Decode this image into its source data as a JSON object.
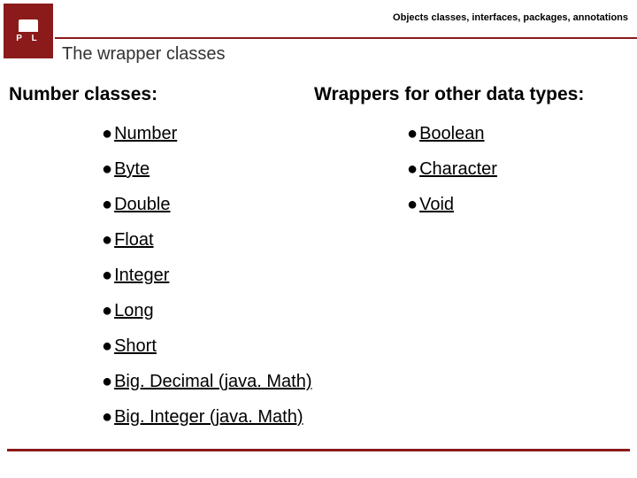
{
  "header": {
    "topic": "Objects classes, interfaces, packages, annotations",
    "title": "The wrapper classes"
  },
  "left": {
    "heading": "Number classes:",
    "items": [
      "Number",
      "Byte",
      "Double",
      "Float",
      "Integer",
      "Long",
      "Short",
      "Big. Decimal (java. Math)",
      "Big. Integer (java. Math)"
    ]
  },
  "right": {
    "heading": "Wrappers for other data types:",
    "items": [
      "Boolean",
      "Character",
      "Void"
    ]
  }
}
